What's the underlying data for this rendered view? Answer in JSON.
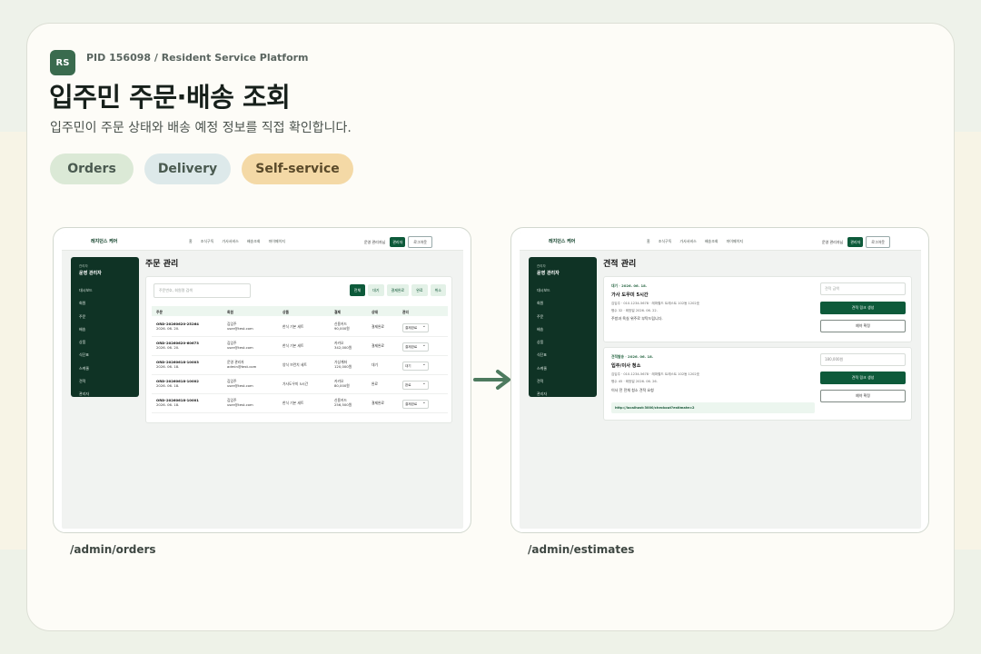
{
  "header": {
    "logo": "RS",
    "pid": "PID 156098 / Resident Service Platform",
    "title": "입주민 주문·배송 조회",
    "subtitle": "입주민이 주문 상태와 배송 예정 정보를 직접 확인합니다."
  },
  "tags": [
    "Orders",
    "Delivery",
    "Self-service"
  ],
  "app": {
    "brand": "레지던스 케어",
    "nav": [
      "홈",
      "조식구독",
      "가사서비스",
      "배송조회",
      "마이페이지"
    ],
    "user": "운영 관리자님",
    "admin_btn": "관리자",
    "logout_btn": "로그아웃",
    "sidebar_role": "관리자",
    "sidebar_name": "운영 관리자",
    "sidebar_items": [
      "대시보드",
      "회원",
      "주문",
      "배송",
      "상품",
      "식단표",
      "스케줄",
      "견적",
      "관리자"
    ]
  },
  "orders": {
    "caption": "/admin/orders",
    "title": "주문 관리",
    "search_placeholder": "주문번호, 회원명 검색",
    "filters": [
      "전체",
      "대기",
      "결제완료",
      "완료",
      "취소"
    ],
    "columns": [
      "주문",
      "회원",
      "상품",
      "결제",
      "상태",
      "관리"
    ],
    "rows": [
      {
        "id": "ORD-20260620-25264",
        "date": "2026. 06. 20.",
        "member": "김입주",
        "email": "user@test.com",
        "product": "한식 기본 세트",
        "pay_method": "신용카드",
        "amount": "90,000원",
        "status": "결제완료",
        "select": "결제완료"
      },
      {
        "id": "ORD-20260620-60673",
        "date": "2026. 06. 20.",
        "member": "김입주",
        "email": "user@test.com",
        "product": "한식 기본 세트",
        "pay_method": "카카오",
        "amount": "342,000원",
        "status": "결제완료",
        "select": "결제완료"
      },
      {
        "id": "ORD-20260618-10003",
        "date": "2026. 06. 18.",
        "member": "운영 관리자",
        "email": "admin@test.com",
        "product": "양식 브런치 세트",
        "pay_method": "가상계좌",
        "amount": "120,000원",
        "status": "대기",
        "select": "대기"
      },
      {
        "id": "ORD-20260618-10002",
        "date": "2026. 06. 18.",
        "member": "김입주",
        "email": "user@test.com",
        "product": "가사도우미 5시간",
        "pay_method": "카카오",
        "amount": "80,000원",
        "status": "완료",
        "select": "완료"
      },
      {
        "id": "ORD-20260618-10001",
        "date": "2026. 06. 18.",
        "member": "김입주",
        "email": "user@test.com",
        "product": "한식 기본 세트",
        "pay_method": "신용카드",
        "amount": "256,500원",
        "status": "결제완료",
        "select": "결제완료"
      }
    ]
  },
  "estimates": {
    "caption": "/admin/estimates",
    "title": "견적 관리",
    "items": [
      {
        "tag": "대기 · 2026. 06. 18.",
        "name": "가사 도우미 5시간",
        "contact": "김입주 · 010-1234-5678 · 레퍼힐드 트레스트 102동 1202호",
        "detail": "평수 32 · 희망일 2026. 06. 22.",
        "note": "주방과 욕실 위주로 부탁드립니다.",
        "input_placeholder": "견적 금액",
        "input_value": "",
        "primary_btn": "견적 링크 생성",
        "secondary_btn": "예약 확정",
        "link": ""
      },
      {
        "tag": "견적발송 · 2026. 06. 18.",
        "name": "입주/이사 청소",
        "contact": "김입주 · 010-1234-5678 · 레퍼힐드 트레스트 102동 1202호",
        "detail": "평수 45 · 희망일 2026. 06. 26.",
        "note": "이사 전 전체 청소 견적 요청",
        "input_placeholder": "",
        "input_value": "180,000원",
        "primary_btn": "견적 링크 생성",
        "secondary_btn": "예약 확정",
        "link": "http://localhost:3000/checkout?estimate=2"
      }
    ]
  }
}
